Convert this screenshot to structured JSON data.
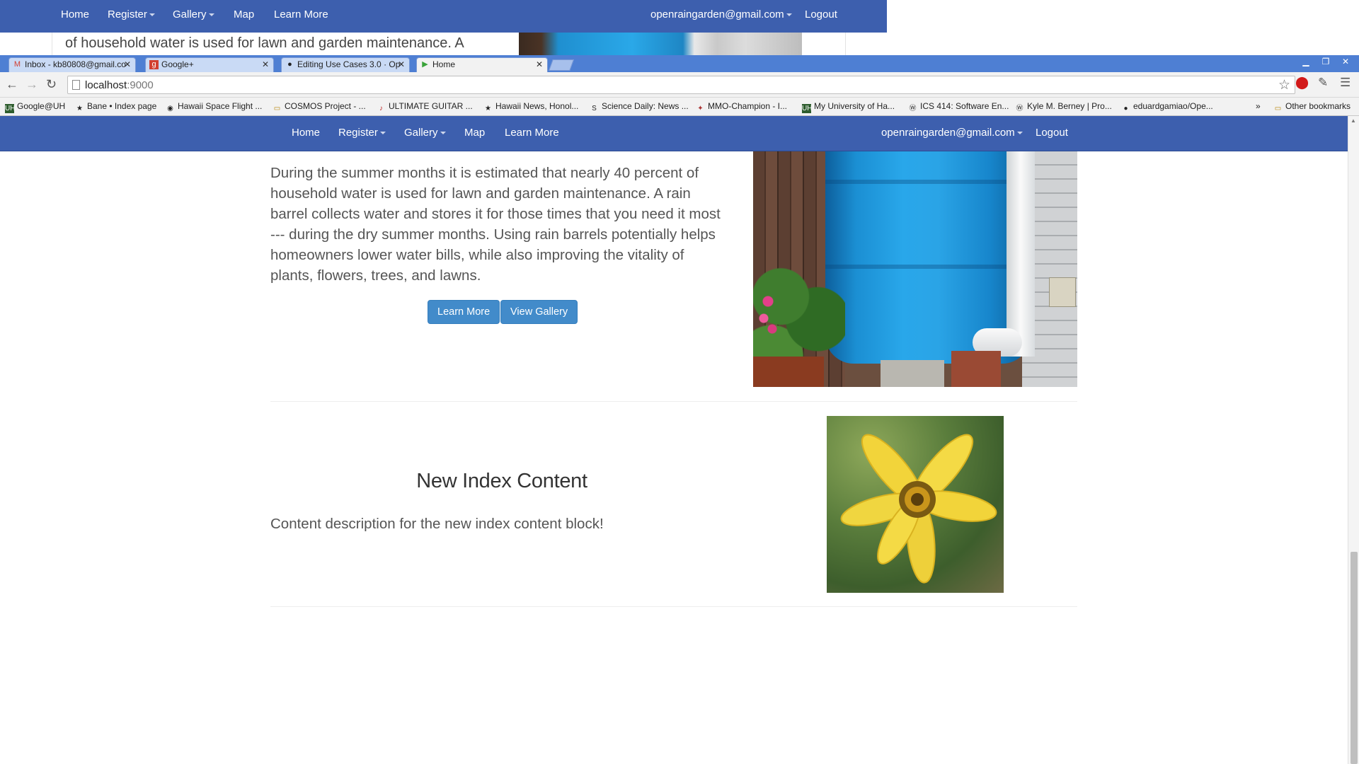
{
  "background_window": {
    "nav": {
      "home": "Home",
      "register": "Register",
      "gallery": "Gallery",
      "map": "Map",
      "learn_more": "Learn More",
      "user_email": "openraingarden@gmail.com",
      "logout": "Logout"
    },
    "partial_text": "of household water is used for lawn and garden maintenance. A"
  },
  "browser": {
    "tabs": [
      {
        "title": "Inbox - kb80808@gmail.co",
        "icon": "gmail-icon"
      },
      {
        "title": "Google+",
        "icon": "google-plus-icon"
      },
      {
        "title": "Editing Use Cases 3.0 · Op",
        "icon": "github-icon"
      },
      {
        "title": "Home",
        "icon": "play-icon",
        "active": true
      }
    ],
    "url_host": "localhost",
    "url_port": ":9000",
    "bookmarks": [
      {
        "label": "Google@UH",
        "icon": "uh-icon"
      },
      {
        "label": "Bane • Index page",
        "icon": "star-icon"
      },
      {
        "label": "Hawaii Space Flight ...",
        "icon": "globe-icon"
      },
      {
        "label": "COSMOS Project - ...",
        "icon": "folder-icon"
      },
      {
        "label": "ULTIMATE GUITAR ...",
        "icon": "guitar-icon"
      },
      {
        "label": "Hawaii News, Honol...",
        "icon": "star-icon"
      },
      {
        "label": "Science Daily: News ...",
        "icon": "sd-icon"
      },
      {
        "label": "MMO-Champion - I...",
        "icon": "champion-icon"
      },
      {
        "label": "My University of Ha...",
        "icon": "uh-icon"
      },
      {
        "label": "ICS 414: Software En...",
        "icon": "wordpress-icon"
      },
      {
        "label": "Kyle M. Berney | Pro...",
        "icon": "wordpress-icon"
      },
      {
        "label": "eduardgamiao/Ope...",
        "icon": "github-icon"
      }
    ],
    "overflow_chevron": "»",
    "other_bookmarks": "Other bookmarks"
  },
  "navbar": {
    "home": "Home",
    "register": "Register",
    "gallery": "Gallery",
    "map": "Map",
    "learn_more": "Learn More",
    "user_email": "openraingarden@gmail.com",
    "logout": "Logout"
  },
  "hero": {
    "text": "During the summer months it is estimated that nearly 40 percent of household water is used for lawn and garden maintenance. A rain barrel collects water and stores it for those times that you need it most --- during the dry summer months. Using rain barrels potentially helps homeowners lower water bills, while also improving the vitality of plants, flowers, trees, and lawns.",
    "learn_more_button": "Learn More",
    "view_gallery_button": "View Gallery"
  },
  "content_block": {
    "heading": "New Index Content",
    "description": "Content description for the new index content block!"
  },
  "colors": {
    "navbar": "#3d5fae",
    "button": "#428bca",
    "text": "#555555"
  }
}
